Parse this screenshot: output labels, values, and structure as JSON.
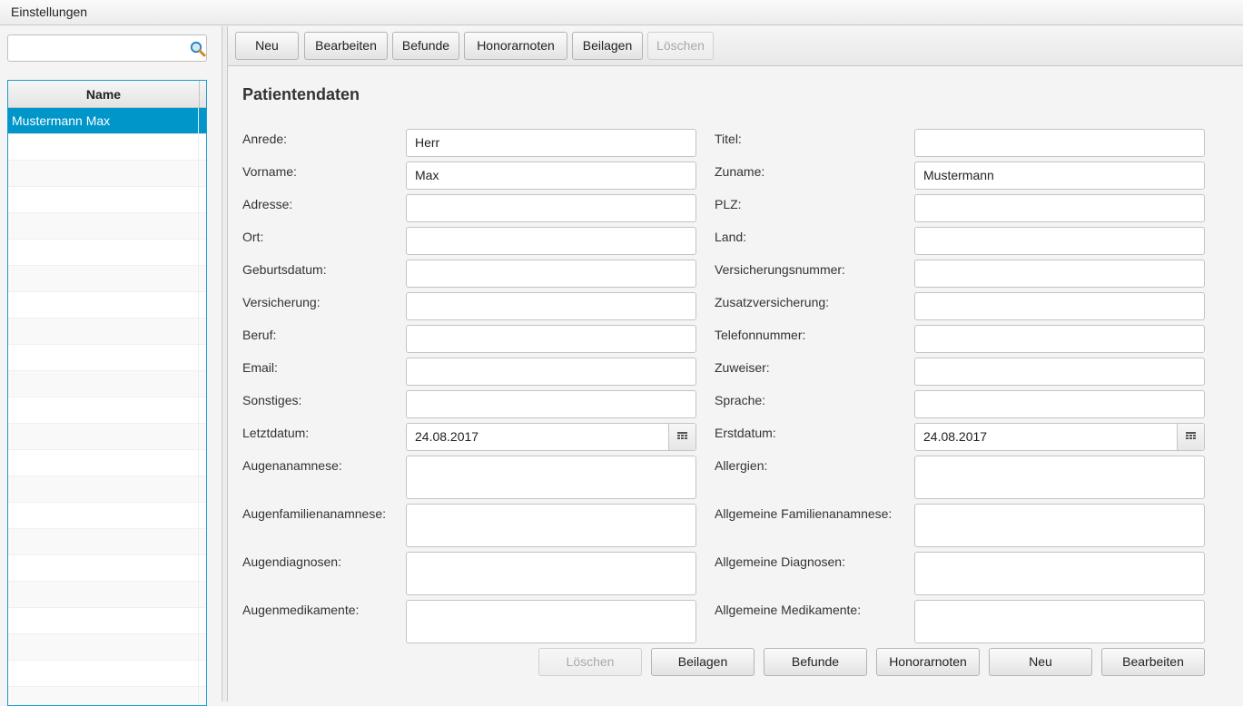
{
  "menu": {
    "settings": "Einstellungen"
  },
  "search": {
    "value": "",
    "placeholder": ""
  },
  "patient_table": {
    "column": "Name",
    "rows": [
      "Mustermann Max"
    ]
  },
  "toolbar": {
    "neu": "Neu",
    "bearbeiten": "Bearbeiten",
    "befunde": "Befunde",
    "honorarnoten": "Honorarnoten",
    "beilagen": "Beilagen",
    "loeschen": "Löschen"
  },
  "form": {
    "title": "Patientendaten",
    "left": [
      {
        "label": "Anrede:",
        "value": "Herr"
      },
      {
        "label": "Vorname:",
        "value": "Max"
      },
      {
        "label": "Adresse:",
        "value": ""
      },
      {
        "label": "Ort:",
        "value": ""
      },
      {
        "label": "Geburtsdatum:",
        "value": ""
      },
      {
        "label": "Versicherung:",
        "value": ""
      },
      {
        "label": "Beruf:",
        "value": ""
      },
      {
        "label": "Email:",
        "value": ""
      },
      {
        "label": "Sonstiges:",
        "value": ""
      },
      {
        "label": "Letztdatum:",
        "value": "24.08.2017"
      },
      {
        "label": "Augenanamnese:",
        "value": ""
      },
      {
        "label": "Augenfamilienanamnese:",
        "value": ""
      },
      {
        "label": "Augendiagnosen:",
        "value": ""
      },
      {
        "label": "Augenmedikamente:",
        "value": ""
      }
    ],
    "right": [
      {
        "label": "Titel:",
        "value": ""
      },
      {
        "label": "Zuname:",
        "value": "Mustermann"
      },
      {
        "label": "PLZ:",
        "value": ""
      },
      {
        "label": "Land:",
        "value": ""
      },
      {
        "label": "Versicherungsnummer:",
        "value": ""
      },
      {
        "label": "Zusatzversicherung:",
        "value": ""
      },
      {
        "label": "Telefonnummer:",
        "value": ""
      },
      {
        "label": "Zuweiser:",
        "value": ""
      },
      {
        "label": "Sprache:",
        "value": ""
      },
      {
        "label": "Erstdatum:",
        "value": "24.08.2017"
      },
      {
        "label": "Allergien:",
        "value": ""
      },
      {
        "label": "Allgemeine Familienanamnese:",
        "value": ""
      },
      {
        "label": "Allgemeine Diagnosen:",
        "value": ""
      },
      {
        "label": "Allgemeine Medikamente:",
        "value": ""
      }
    ]
  },
  "bottom_buttons": {
    "loeschen": "Löschen",
    "beilagen": "Beilagen",
    "befunde": "Befunde",
    "honorarnoten": "Honorarnoten",
    "neu": "Neu",
    "bearbeiten": "Bearbeiten"
  },
  "icons": {
    "search": "search-icon",
    "calendar": "calendar-icon"
  },
  "colors": {
    "selection": "#0096c9",
    "table_border": "#1c9bd0"
  }
}
